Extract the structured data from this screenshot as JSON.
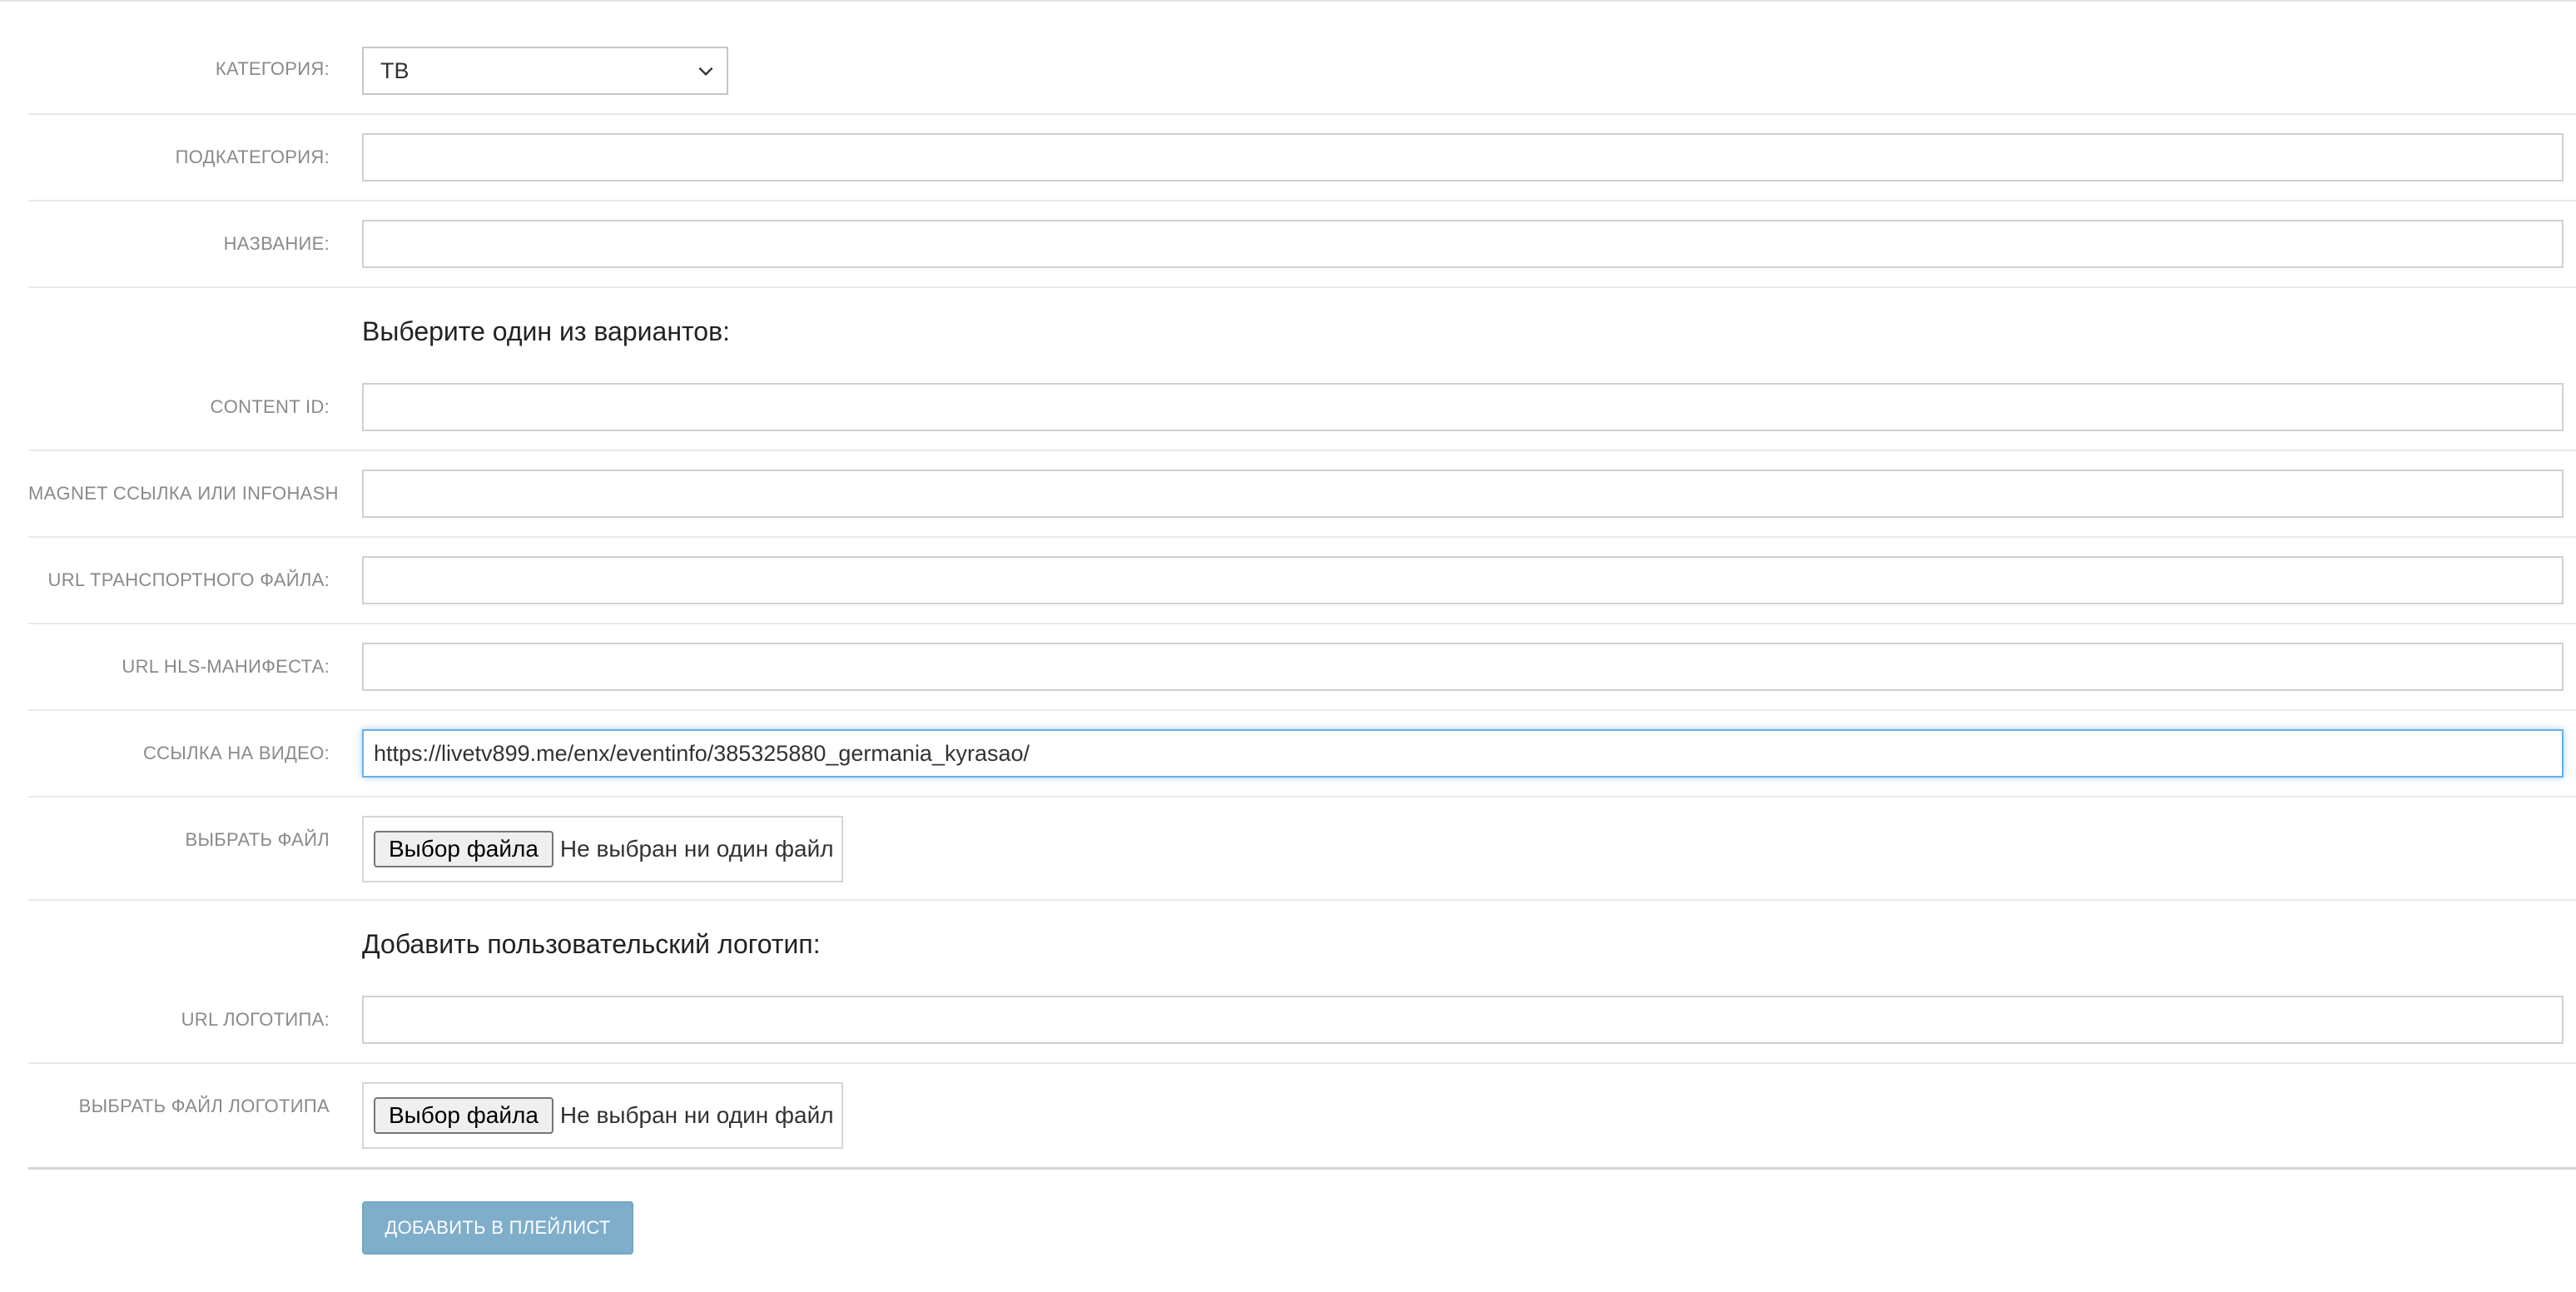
{
  "form": {
    "category": {
      "label": "КАТЕГОРИЯ:",
      "value": "ТВ"
    },
    "subcategory": {
      "label": "ПОДКАТЕГОРИЯ:",
      "value": ""
    },
    "name": {
      "label": "НАЗВАНИЕ:",
      "value": ""
    },
    "choose_section_title": "Выберите один из вариантов:",
    "content_id": {
      "label": "CONTENT ID:",
      "value": ""
    },
    "magnet": {
      "label": "MAGNET ССЫЛКА ИЛИ INFOHASH",
      "value": ""
    },
    "transport_url": {
      "label": "URL ТРАНСПОРТНОГО ФАЙЛА:",
      "value": ""
    },
    "hls_url": {
      "label": "URL HLS-МАНИФЕСТА:",
      "value": ""
    },
    "video_link": {
      "label": "ССЫЛКА НА ВИДЕО:",
      "value": "https://livetv899.me/enx/eventinfo/385325880_germania_kyrasao/"
    },
    "choose_file": {
      "label": "ВЫБРАТЬ ФАЙЛ",
      "button": "Выбор файла",
      "status": "Не выбран ни один файл"
    },
    "logo_section_title": "Добавить пользовательский логотип:",
    "logo_url": {
      "label": "URL ЛОГОТИПА:",
      "value": ""
    },
    "choose_logo_file": {
      "label": "ВЫБРАТЬ ФАЙЛ ЛОГОТИПА",
      "button": "Выбор файла",
      "status": "Не выбран ни один файл"
    },
    "submit_label": "ДОБАВИТЬ В ПЛЕЙЛИСТ"
  },
  "colors": {
    "label_text": "#8a8a8a",
    "input_border": "#d0d0d0",
    "focus_border": "#66afe9",
    "submit_bg": "#7faecb"
  },
  "icons": {
    "select_arrow": "chevron-down-icon"
  }
}
